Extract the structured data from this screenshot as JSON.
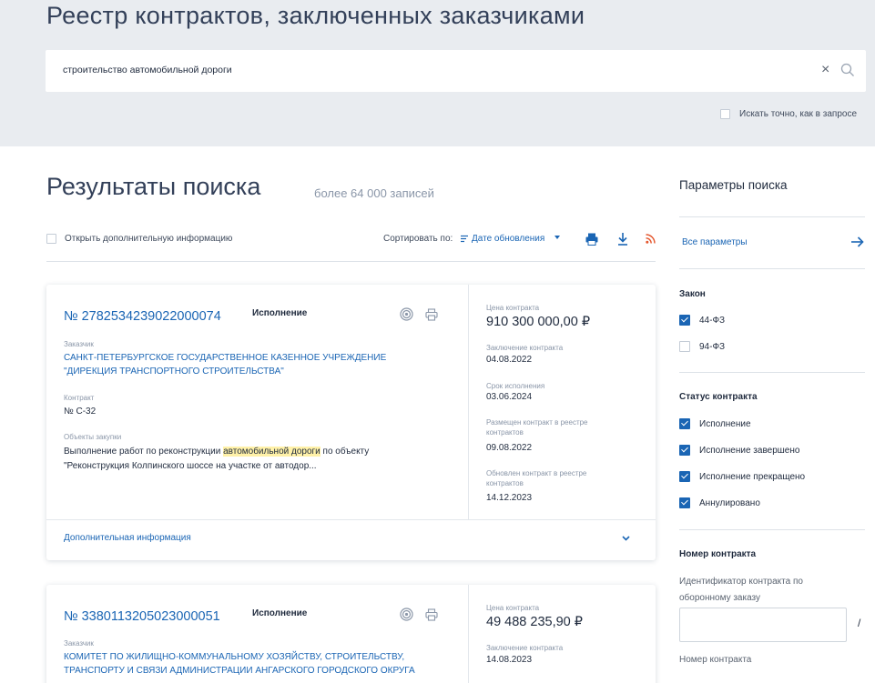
{
  "header": {
    "title": "Реестр контрактов, заключенных заказчиками",
    "search_value": "строительство автомобильной дороги",
    "exact_label": "Искать точно, как в запросе"
  },
  "results": {
    "title": "Результаты поиска",
    "count": "более 64 000 записей",
    "open_info_label": "Открыть дополнительную информацию",
    "sort_label": "Сортировать по:",
    "sort_value": "Дате обновления"
  },
  "cards": [
    {
      "number": "№ 2782534239022000074",
      "status": "Исполнение",
      "customer_label": "Заказчик",
      "customer_line1": "САНКТ-ПЕТЕРБУРГСКОЕ ГОСУДАРСТВЕННОЕ КАЗЕННОЕ УЧРЕЖДЕНИЕ",
      "customer_line2": "\"ДИРЕКЦИЯ ТРАНСПОРТНОГО СТРОИТЕЛЬСТВА\"",
      "contract_label": "Контракт",
      "contract_value": "№ С-32",
      "objects_label": "Объекты закупки",
      "objects_pre": "Выполнение работ по реконструкции ",
      "objects_hl": "автомобильной дороги",
      "objects_post": " по объекту",
      "objects_line2": "\"Реконструкция Колпинского шоссе на участке от автодор...",
      "price_label": "Цена контракта",
      "price": "910 300 000,00 ₽",
      "conclusion_label": "Заключение контракта",
      "conclusion_date": "04.08.2022",
      "term_label": "Срок исполнения",
      "term_date": "03.06.2024",
      "placed_label_1": "Размещен контракт в реестре",
      "placed_label_2": "контрактов",
      "placed_date": "09.08.2022",
      "updated_label_1": "Обновлен контракт в реестре",
      "updated_label_2": "контрактов",
      "updated_date": "14.12.2023",
      "more_info": "Дополнительная информация"
    },
    {
      "number": "№ 3380113205023000051",
      "status": "Исполнение",
      "customer_label": "Заказчик",
      "customer_line1": "КОМИТЕТ ПО ЖИЛИЩНО-КОММУНАЛЬНОМУ ХОЗЯЙСТВУ, СТРОИТЕЛЬСТВУ,",
      "customer_line2": "ТРАНСПОРТУ И СВЯЗИ АДМИНИСТРАЦИИ АНГАРСКОГО ГОРОДСКОГО ОКРУГА",
      "price_label": "Цена контракта",
      "price": "49 488 235,90 ₽",
      "conclusion_label": "Заключение контракта",
      "conclusion_date": "14.08.2023"
    }
  ],
  "sidebar": {
    "title": "Параметры поиска",
    "all_params": "Все параметры",
    "law_heading": "Закон",
    "law_options": [
      {
        "label": "44-ФЗ",
        "checked": true
      },
      {
        "label": "94-ФЗ",
        "checked": false
      }
    ],
    "status_heading": "Статус контракта",
    "status_options": [
      {
        "label": "Исполнение",
        "checked": true
      },
      {
        "label": "Исполнение завершено",
        "checked": true
      },
      {
        "label": "Исполнение прекращено",
        "checked": true
      },
      {
        "label": "Аннулировано",
        "checked": true
      }
    ],
    "number_heading": "Номер контракта",
    "defense_id_label": "Идентификатор контракта по оборонному заказу",
    "slash": "/",
    "contract_number_label": "Номер контракта"
  },
  "colors": {
    "accent": "#1a65b4",
    "band": "#e9ecf0",
    "highlight": "#fff1a8"
  }
}
